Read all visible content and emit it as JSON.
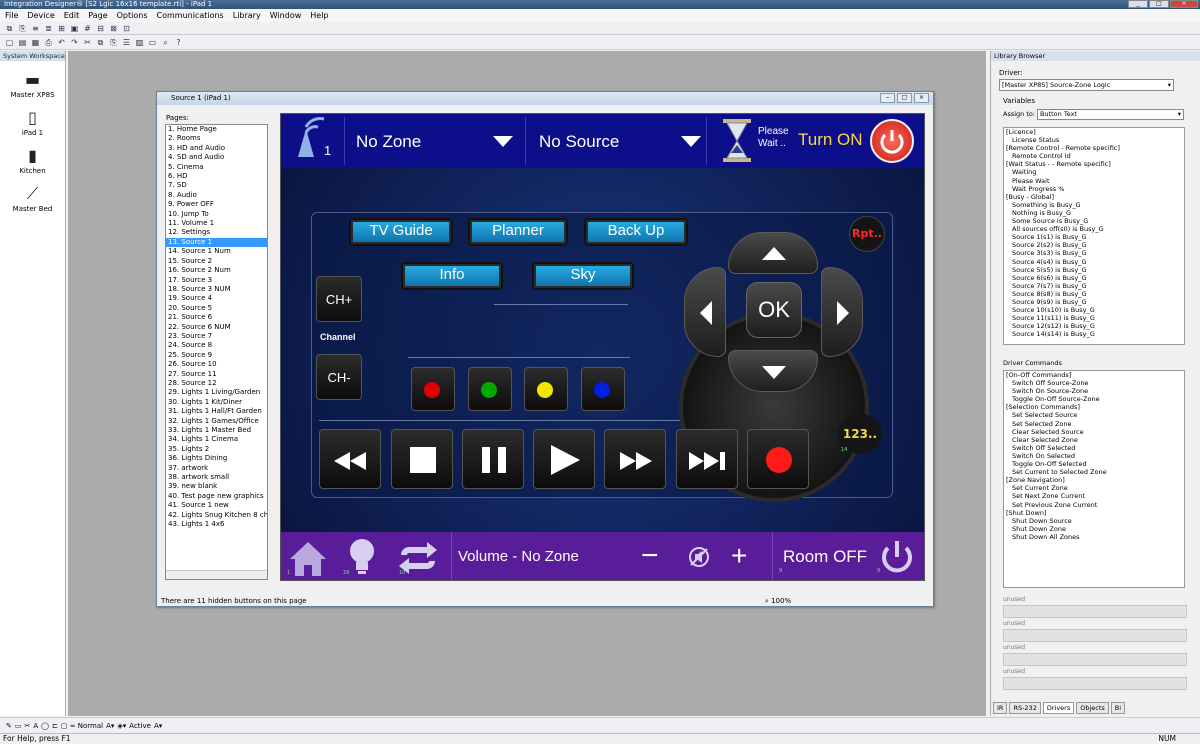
{
  "window": {
    "title": "Integration Designer® [S2 Lgic 16x16 template.rti] - iPad 1"
  },
  "menu": [
    "File",
    "Device",
    "Edit",
    "Page",
    "Options",
    "Communications",
    "Library",
    "Window",
    "Help"
  ],
  "left_panel": {
    "header": "System Workspace",
    "devices": [
      {
        "label": "Master XP8S",
        "icon": "master-device-icon"
      },
      {
        "label": "iPad 1",
        "icon": "ipad-icon"
      },
      {
        "label": "Kitchen",
        "icon": "remote-icon"
      },
      {
        "label": "Master Bed",
        "icon": "remote-icon"
      }
    ]
  },
  "document": {
    "title": "Source 1 (iPad 1)",
    "pages_label": "Pages:",
    "pages": [
      "1. Home Page",
      "2. Rooms",
      "3. HD and Audio",
      "4. SD and Audio",
      "5. Cinema",
      "6. HD",
      "7. SD",
      "8. Audio",
      "9. Power OFF",
      "10. Jump To",
      "11. Volume 1",
      "12. Settings",
      "13. Source 1",
      "14. Source 1 Num",
      "15. Source 2",
      "16. Source 2 Num",
      "17. Source 3",
      "18. Source 3 NUM",
      "19. Source 4",
      "20. Source 5",
      "21. Source 6",
      "22. Source 6 NUM",
      "23. Source 7",
      "24. Source 8",
      "25. Source 9",
      "26. Source 10",
      "27. Source 11",
      "28. Source 12",
      "29. Lights 1 Living/Garden",
      "30. Lights 1 Kit/Diner",
      "31. Lights 1 Hall/Ft Garden",
      "32. Lights 1 Games/Office",
      "33. Lights 1 Master Bed",
      "34. Lights 1 Cinema",
      "35. Lights 2",
      "36. Lights Dining",
      "37. artwork",
      "38. artwork small",
      "39. new blank",
      "40. Test page new graphics",
      "41. Source 1 new",
      "42. Lights Snug Kitchen 8 char",
      "43. Lights 1 4x6"
    ],
    "selected_page": "13. Source 1",
    "status": "There are 11 hidden buttons on this page",
    "zoom": "100%"
  },
  "remote": {
    "zone_count": "1",
    "zone": "No Zone",
    "source": "No Source",
    "please_wait": "Please Wait ..",
    "turn_on": "Turn ON",
    "buttons": {
      "tv_guide": "TV Guide",
      "planner": "Planner",
      "back_up": "Back Up",
      "info": "Info",
      "sky": "Sky",
      "rpt": "Rpt..",
      "ch_plus": "CH+",
      "channel": "Channel",
      "ch_minus": "CH-",
      "ok": "OK",
      "num": "123..",
      "num_badge": "14"
    },
    "colors": [
      "#e00000",
      "#00aa00",
      "#f2e600",
      "#0020e0"
    ],
    "bottom": {
      "home_badge": "1",
      "light_badge": "29",
      "swap_badge": "10",
      "volume": "Volume - No Zone",
      "room_off": "Room OFF",
      "room_off_badge": "9",
      "power_badge": "9"
    }
  },
  "library": {
    "header": "Library Browser",
    "driver_label": "Driver:",
    "driver_value": "[Master XP8S] Source-Zone Logic",
    "variables_label": "Variables",
    "assign_label": "Assign to:",
    "assign_value": "Button Text",
    "variables": [
      {
        "t": "[Licence]",
        "i": 0
      },
      {
        "t": "License Status",
        "i": 1
      },
      {
        "t": "[Remote Control - Remote specific]",
        "i": 0
      },
      {
        "t": "Remote Control Id",
        "i": 1
      },
      {
        "t": "[Wait Status - - Remote specific]",
        "i": 0
      },
      {
        "t": "Waiting",
        "i": 1
      },
      {
        "t": "Please Wait",
        "i": 1
      },
      {
        "t": "Wait Progress %",
        "i": 1
      },
      {
        "t": "[Busy - Global]",
        "i": 0
      },
      {
        "t": "Something is Busy_G",
        "i": 1
      },
      {
        "t": "Nothing is Busy_G",
        "i": 1
      },
      {
        "t": "Some Source is Busy_G",
        "i": 1
      },
      {
        "t": "All sources off(s0) is Busy_G",
        "i": 1
      },
      {
        "t": "Source 1(s1) is Busy_G",
        "i": 1
      },
      {
        "t": "Source 2(s2) is Busy_G",
        "i": 1
      },
      {
        "t": "Source 3(s3) is Busy_G",
        "i": 1
      },
      {
        "t": "Source 4(s4) is Busy_G",
        "i": 1
      },
      {
        "t": "Source 5(s5) is Busy_G",
        "i": 1
      },
      {
        "t": "Source 6(s6) is Busy_G",
        "i": 1
      },
      {
        "t": "Source 7(s7) is Busy_G",
        "i": 1
      },
      {
        "t": "Source 8(s8) is Busy_G",
        "i": 1
      },
      {
        "t": "Source 9(s9) is Busy_G",
        "i": 1
      },
      {
        "t": "Source 10(s10) is Busy_G",
        "i": 1
      },
      {
        "t": "Source 11(s11) is Busy_G",
        "i": 1
      },
      {
        "t": "Source 12(s12) is Busy_G",
        "i": 1
      },
      {
        "t": "Source 14(s14) is Busy_G",
        "i": 1
      }
    ],
    "commands_label": "Driver Commands",
    "commands": [
      {
        "t": "[On-Off Commands]",
        "i": 0
      },
      {
        "t": "Switch Off Source-Zone",
        "i": 1
      },
      {
        "t": "Switch On Source-Zone",
        "i": 1
      },
      {
        "t": "Toggle On-Off Source-Zone",
        "i": 1
      },
      {
        "t": "[Selection Commands]",
        "i": 0
      },
      {
        "t": "Set Selected Source",
        "i": 1
      },
      {
        "t": "Set Selected Zone",
        "i": 1
      },
      {
        "t": "Clear Selected Source",
        "i": 1
      },
      {
        "t": "Clear Selected Zone",
        "i": 1
      },
      {
        "t": "Switch Off Selected",
        "i": 1
      },
      {
        "t": "Switch On Selected",
        "i": 1
      },
      {
        "t": "Toggle On-Off Selected",
        "i": 1
      },
      {
        "t": "Set Current to Selected Zone",
        "i": 1
      },
      {
        "t": "[Zone Navigation]",
        "i": 0
      },
      {
        "t": "Set Current Zone",
        "i": 1
      },
      {
        "t": "Set Next Zone Current",
        "i": 1
      },
      {
        "t": "Set Previous Zone Current",
        "i": 1
      },
      {
        "t": "[Shut Down]",
        "i": 0
      },
      {
        "t": "Shut Down Source",
        "i": 1
      },
      {
        "t": "Shut Down Zone",
        "i": 1
      },
      {
        "t": "Shut Down All Zones",
        "i": 1
      }
    ],
    "unused": [
      "unused",
      "unused",
      "unused",
      "unused"
    ],
    "tabs": [
      "IR",
      "RS-232",
      "Drivers",
      "Objects",
      "Bi"
    ]
  },
  "bottom_tools": {
    "text_style": "Normal",
    "active": "Active"
  },
  "statusbar": {
    "left": "For Help, press F1",
    "right": "NUM"
  }
}
